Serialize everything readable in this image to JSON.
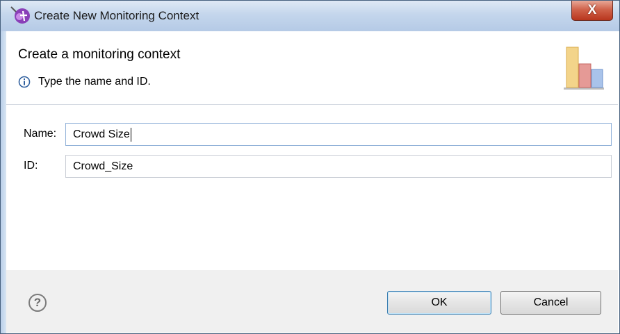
{
  "window": {
    "title": "Create New Monitoring Context",
    "close_glyph": "X",
    "title_icon": "monitor-model-icon"
  },
  "header": {
    "title": "Create a monitoring context",
    "message": "Type the name and ID.",
    "message_icon": "info-icon",
    "graphic": "bar-chart-graphic"
  },
  "form": {
    "name_label": "Name:",
    "name_value": "Crowd Size",
    "id_label": "ID:",
    "id_value": "Crowd_Size"
  },
  "footer": {
    "help_glyph": "?",
    "ok_label": "OK",
    "cancel_label": "Cancel"
  },
  "colors": {
    "title_bar": "#c4d6ec",
    "close_button": "#c94a31",
    "footer_bg": "#f0f0f0",
    "default_button_border": "#3c7fb1"
  }
}
